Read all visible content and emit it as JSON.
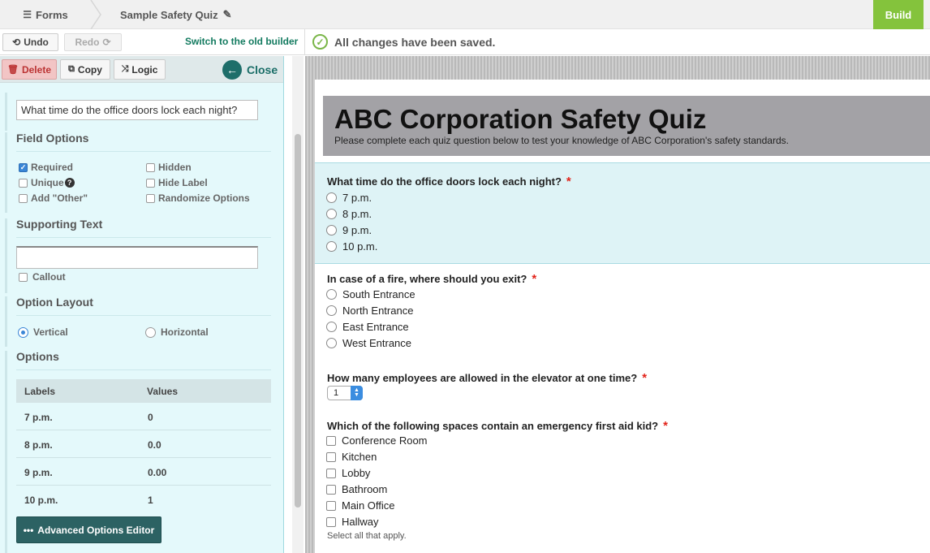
{
  "topbar": {
    "forms_label": "Forms",
    "form_name": "Sample Safety Quiz",
    "build_label": "Build"
  },
  "toolbar": {
    "undo_label": "Undo",
    "redo_label": "Redo",
    "old_builder_label": "Switch to the old builder",
    "saved_status": "All changes have been saved."
  },
  "field_panel": {
    "delete_label": "Delete",
    "copy_label": "Copy",
    "logic_label": "Logic",
    "close_label": "Close",
    "field_label_value": "What time do the office doors lock each night?",
    "field_options_title": "Field Options",
    "options_checkboxes": [
      {
        "label": "Required",
        "checked": true
      },
      {
        "label": "Hidden",
        "checked": false
      },
      {
        "label": "Unique",
        "checked": false
      },
      {
        "label": "Hide Label",
        "checked": false
      },
      {
        "label": "Add \"Other\"",
        "checked": false
      },
      {
        "label": "Randomize Options",
        "checked": false
      }
    ],
    "supporting_text_title": "Supporting Text",
    "supporting_text_value": "",
    "callout_label": "Callout",
    "option_layout_title": "Option Layout",
    "layout_vertical": "Vertical",
    "layout_horizontal": "Horizontal",
    "options_title": "Options",
    "table_headers": {
      "labels": "Labels",
      "values": "Values"
    },
    "option_rows": [
      {
        "label": "7 p.m.",
        "value": "0"
      },
      {
        "label": "8 p.m.",
        "value": "0.0"
      },
      {
        "label": "9 p.m.",
        "value": "0.00"
      },
      {
        "label": "10 p.m.",
        "value": "1"
      }
    ],
    "advanced_label": "Advanced Options Editor"
  },
  "form": {
    "title": "ABC Corporation Safety Quiz",
    "description": "Please complete each quiz question below to test your knowledge of ABC Corporation's safety standards.",
    "required_mark": "*",
    "questions": [
      {
        "title": "What time do the office doors lock each night?",
        "options": [
          "7 p.m.",
          "8 p.m.",
          "9 p.m.",
          "10 p.m."
        ]
      },
      {
        "title": "In case of a fire, where should you exit?",
        "options": [
          "South Entrance",
          "North Entrance",
          "East Entrance",
          "West Entrance"
        ]
      },
      {
        "title": "How many employees are allowed in the elevator at one time?",
        "selected": "1"
      },
      {
        "title": "Which of the following spaces contain an emergency first aid kid?",
        "options": [
          "Conference Room",
          "Kitchen",
          "Lobby",
          "Bathroom",
          "Main Office",
          "Hallway"
        ],
        "help": "Select all that apply."
      }
    ]
  },
  "colors": {
    "build": "#84c33c",
    "panel_bg": "#e4f9fb",
    "accent_teal": "#1b6e68",
    "required_red": "#e2231a",
    "form_header": "#a3a2a6"
  }
}
